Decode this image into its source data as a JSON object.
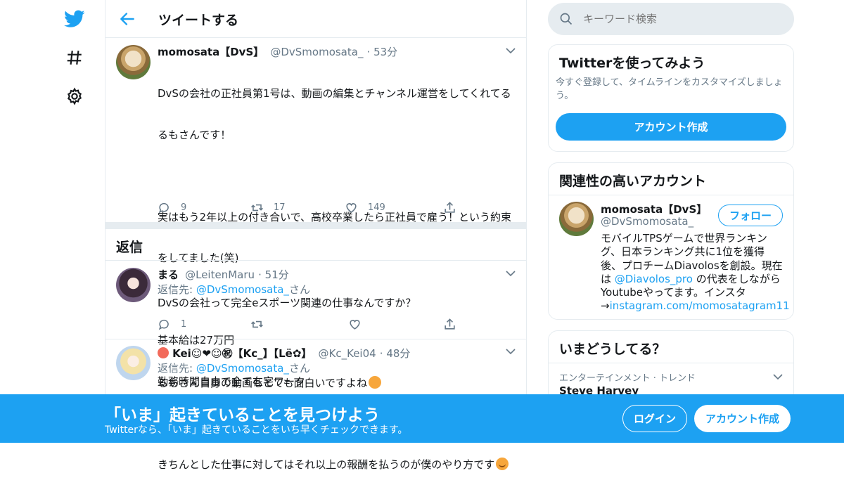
{
  "nav": {
    "logo_icon": "twitter-bird-icon",
    "explore_icon": "hashtag-icon",
    "settings_icon": "gear-icon"
  },
  "header": {
    "title": "ツイートする",
    "back_icon": "arrow-left-icon"
  },
  "main_tweet": {
    "name": "momosata【DvS】",
    "handle": "@DvSmomosata_",
    "time": "53分",
    "text_lines": [
      "DvSの会社の正社員第1号は、動画の編集とチャンネル運営をしてくれてる",
      "るもさんです！",
      "",
      "実はもう2年以上の付き合いで、高校卒業したら正社員で雇う！という約束",
      "をしてました(笑)",
      "",
      "基本給は27万円",
      "勤務時間自由で全て在宅ワーク",
      "",
      "きちんとした仕事に対してはそれ以上の報酬を払うのが僕のやり方です"
    ],
    "reply_count": "9",
    "retweet_count": "17",
    "like_count": "149"
  },
  "replies_section": {
    "title": "返信"
  },
  "replies": [
    {
      "name": "まる",
      "handle": "@LeitenMaru",
      "time": "51分",
      "reply_to_prefix": "返信先: ",
      "reply_to_handle": "@DvSmomosata_",
      "reply_to_suffix": "さん",
      "text": "DvSの会社って完全eスポーツ関連の仕事なんですか？",
      "reply_count": "1"
    },
    {
      "name": "Kei☺❤☺㊗【Kc_】【Lё✿】",
      "handle": "@Kc_Kei04",
      "time": "48分",
      "reply_to_prefix": "返信先: ",
      "reply_to_handle": "@DvSmomosata_",
      "reply_to_suffix": "さん",
      "text": "るもさん自身の動画もとても面白いですよね"
    }
  ],
  "search": {
    "placeholder": "キーワード検索"
  },
  "signup_card": {
    "title": "Twitterを使ってみよう",
    "desc": "今すぐ登録して、タイムラインをカスタマイズしましょう。",
    "button": "アカウント作成"
  },
  "related_card": {
    "title": "関連性の高いアカウント",
    "name": "momosata【DvS】",
    "handle": "@DvSmomosata_",
    "follow_button": "フォロー",
    "bio_1": "モバイルTPSゲームで世界ランキング、日本ランキング共に1位を獲得後、プロチームDiavolosを創設。現在は ",
    "bio_link": "@Diavolos_pro",
    "bio_2": " の代表をしながらYoutubeやってます。インスタ→",
    "bio_link2": "instagram.com/momosatagram11"
  },
  "trends_card": {
    "title": "いまどうしてる？",
    "category": "エンターテインメント · トレンド",
    "trend": "Steve Harvey"
  },
  "banner": {
    "title": "「いま」起きていることを見つけよう",
    "subtitle": "Twitterなら、「いま」起きていることをいち早くチェックできます。",
    "login": "ログイン",
    "signup": "アカウント作成"
  },
  "colors": {
    "accent": "#1da1f2",
    "muted": "#657786",
    "border": "#e6ecf0"
  }
}
